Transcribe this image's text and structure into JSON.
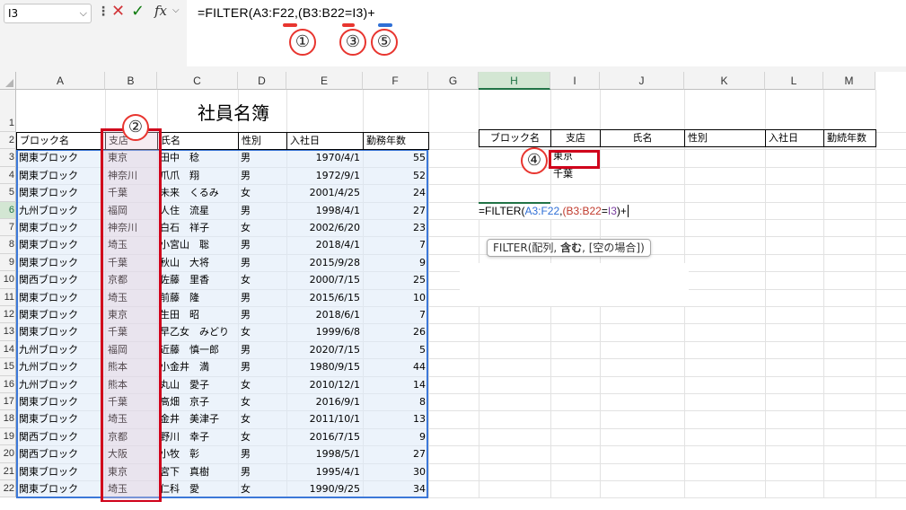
{
  "formula_bar": {
    "name_box": "I3",
    "formula": "=FILTER(A3:F22,(B3:B22=I3)+",
    "fx": "fx"
  },
  "annotations": [
    "①",
    "②",
    "③",
    "④",
    "⑤"
  ],
  "columns": [
    "A",
    "B",
    "C",
    "D",
    "E",
    "F",
    "G",
    "H",
    "I",
    "J",
    "K",
    "L",
    "M"
  ],
  "rows": [
    "1",
    "2",
    "3",
    "4",
    "5",
    "6",
    "7",
    "8",
    "9",
    "10",
    "11",
    "12",
    "13",
    "14",
    "15",
    "16",
    "17",
    "18",
    "19",
    "20",
    "21",
    "22"
  ],
  "sheet_title": "社員名簿",
  "table_headers": [
    "ブロック名",
    "支店",
    "氏名",
    "性別",
    "入社日",
    "勤務年数"
  ],
  "table_rows": [
    [
      "関東ブロック",
      "東京",
      "田中　稔",
      "男",
      "1970/4/1",
      "55"
    ],
    [
      "関東ブロック",
      "神奈川",
      "爪爪　翔",
      "男",
      "1972/9/1",
      "52"
    ],
    [
      "関東ブロック",
      "千葉",
      "未来　くるみ",
      "女",
      "2001/4/25",
      "24"
    ],
    [
      "九州ブロック",
      "福岡",
      "人住　流星",
      "男",
      "1998/4/1",
      "27"
    ],
    [
      "関東ブロック",
      "神奈川",
      "白石　祥子",
      "女",
      "2002/6/20",
      "23"
    ],
    [
      "関東ブロック",
      "埼玉",
      "小宮山　聡",
      "男",
      "2018/4/1",
      "7"
    ],
    [
      "関東ブロック",
      "千葉",
      "秋山　大将",
      "男",
      "2015/9/28",
      "9"
    ],
    [
      "関西ブロック",
      "京都",
      "佐藤　里香",
      "女",
      "2000/7/15",
      "25"
    ],
    [
      "関東ブロック",
      "埼玉",
      "前藤　隆",
      "男",
      "2015/6/15",
      "10"
    ],
    [
      "関東ブロック",
      "東京",
      "生田　昭",
      "男",
      "2018/6/1",
      "7"
    ],
    [
      "関東ブロック",
      "千葉",
      "早乙女　みどり",
      "女",
      "1999/6/8",
      "26"
    ],
    [
      "九州ブロック",
      "福岡",
      "近藤　慎一郎",
      "男",
      "2020/7/15",
      "5"
    ],
    [
      "九州ブロック",
      "熊本",
      "小金井　満",
      "男",
      "1980/9/15",
      "44"
    ],
    [
      "九州ブロック",
      "熊本",
      "丸山　愛子",
      "女",
      "2010/12/1",
      "14"
    ],
    [
      "関東ブロック",
      "千葉",
      "高畑　京子",
      "女",
      "2016/9/1",
      "8"
    ],
    [
      "関東ブロック",
      "埼玉",
      "金井　美津子",
      "女",
      "2011/10/1",
      "13"
    ],
    [
      "関西ブロック",
      "京都",
      "野川　幸子",
      "女",
      "2016/7/15",
      "9"
    ],
    [
      "関西ブロック",
      "大阪",
      "小牧　彰",
      "男",
      "1998/5/1",
      "27"
    ],
    [
      "関東ブロック",
      "東京",
      "宮下　真樹",
      "男",
      "1995/4/1",
      "30"
    ],
    [
      "関東ブロック",
      "埼玉",
      "仁科　愛",
      "女",
      "1990/9/25",
      "34"
    ]
  ],
  "right_headers": [
    "ブロック名",
    "支店",
    "氏名",
    "性別",
    "入社日",
    "勤続年数"
  ],
  "criteria": [
    "東京",
    "千葉"
  ],
  "cell_formula": {
    "p1": "=FILTER(",
    "p2": "A3:F22",
    "p3": ",",
    "p4": "(B3:B22",
    "p5": "=",
    "p6": "I3",
    "p7": ")+"
  },
  "tooltip": {
    "fn": "FILTER(",
    "a1": "配列",
    "sep1": ", ",
    "a2": "含む",
    "sep2": ", ",
    "a3": "[空の場合]",
    "end": ")"
  }
}
